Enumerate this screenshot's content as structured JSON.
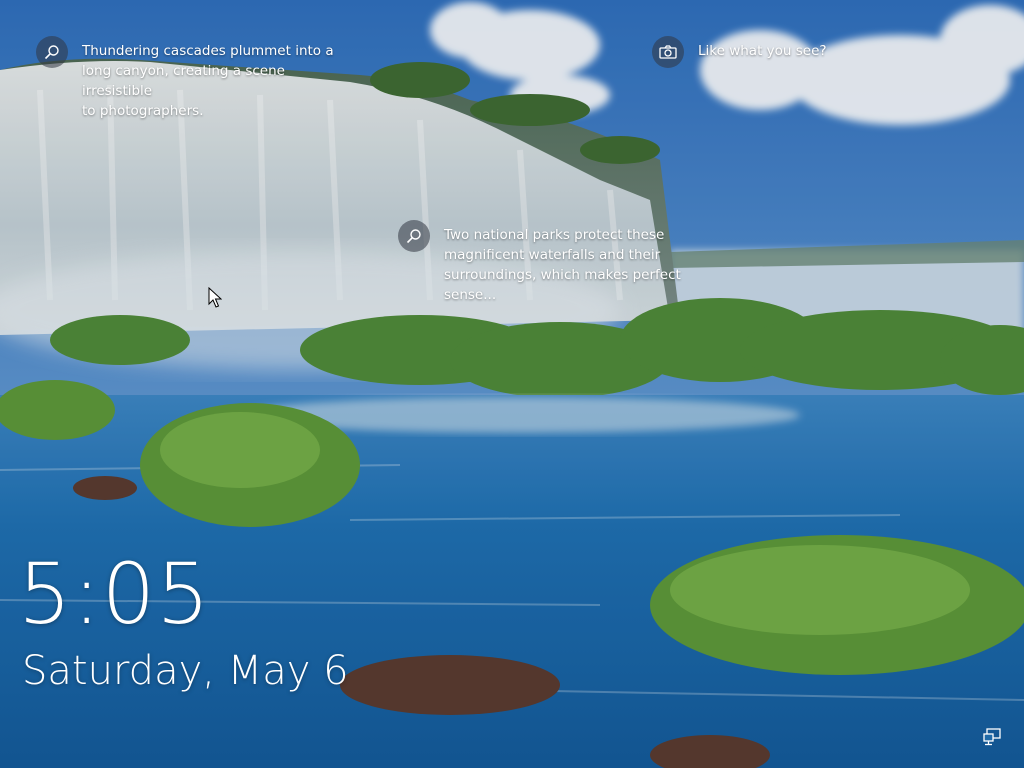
{
  "lockscreen": {
    "hotspots": [
      {
        "icon": "search-icon",
        "text": "Thundering cascades plummet into a\nlong canyon, creating a scene irresistible\nto photographers."
      },
      {
        "icon": "camera-icon",
        "text": "Like what you see?"
      },
      {
        "icon": "search-icon",
        "text": "Two national parks protect these\nmagnificent waterfalls and their\nsurroundings, which makes perfect\nsense..."
      }
    ],
    "time": "5:05",
    "date": "Saturday, May 6",
    "tray_icon": "network-icon"
  },
  "colors": {
    "sky": "#4f86c8",
    "water": "#1a6aae",
    "foliage": "#5f8f3c",
    "waterfall": "#e8eef2"
  }
}
